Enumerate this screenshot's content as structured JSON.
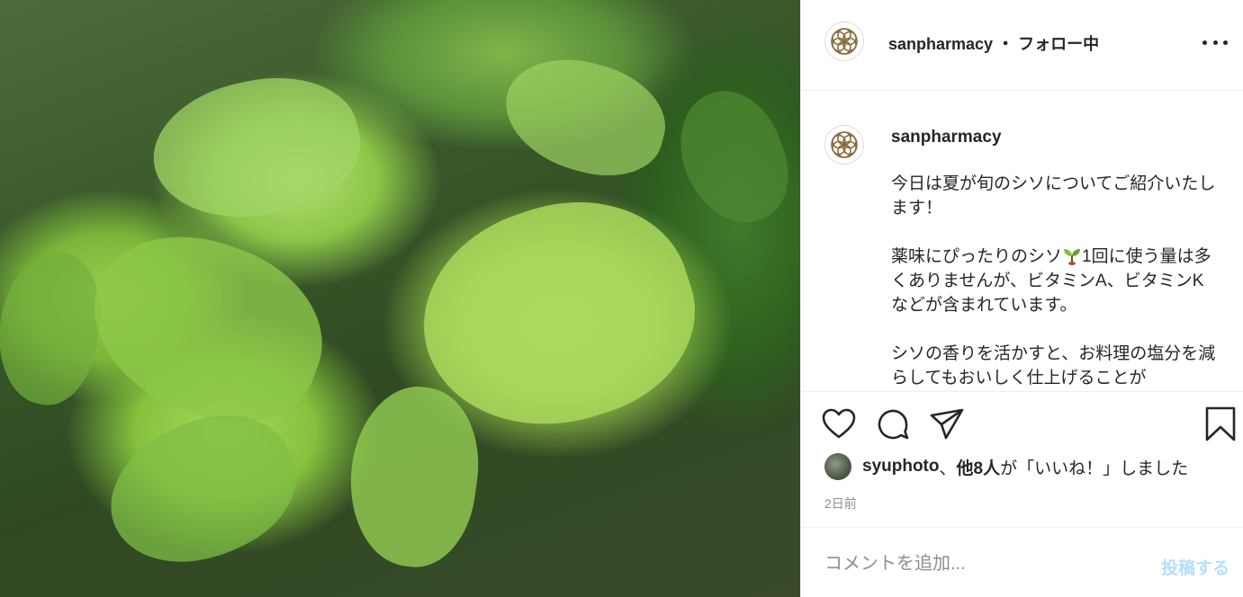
{
  "post": {
    "image_alt": "shiso plant photo",
    "author": "sanpharmacy",
    "separator": "・",
    "follow_status": "フォロー中",
    "more_icon": "more-horizontal-icon",
    "caption": {
      "author": "sanpharmacy",
      "paragraphs": [
        "今日は夏が旬のシソについてご紹介いたします！",
        "薬味にぴったりのシソ",
        "シソの香りを活かすと、お料理の塩分を減らしてもおいしく仕上げることが"
      ],
      "p2_after_emoji": "1回に使う量は多くありませんが、ビタミンA、ビタミンKなどが含まれています。",
      "emoji_icon": "sprout-icon"
    },
    "actions": {
      "like_icon": "heart-icon",
      "comment_icon": "comment-icon",
      "share_icon": "share-icon",
      "save_icon": "bookmark-icon"
    },
    "likes": {
      "user": "syuphoto",
      "middle": "、",
      "others": "他8人",
      "suffix": "が「いいね！」しました"
    },
    "time_ago": "2日前",
    "comment_box": {
      "placeholder": "コメントを追加...",
      "post_label": "投稿する"
    },
    "colors": {
      "post_button_disabled": "#b2dffc",
      "muted_text": "#8e8e8e",
      "brand_gold": "#8a6a3c"
    }
  }
}
